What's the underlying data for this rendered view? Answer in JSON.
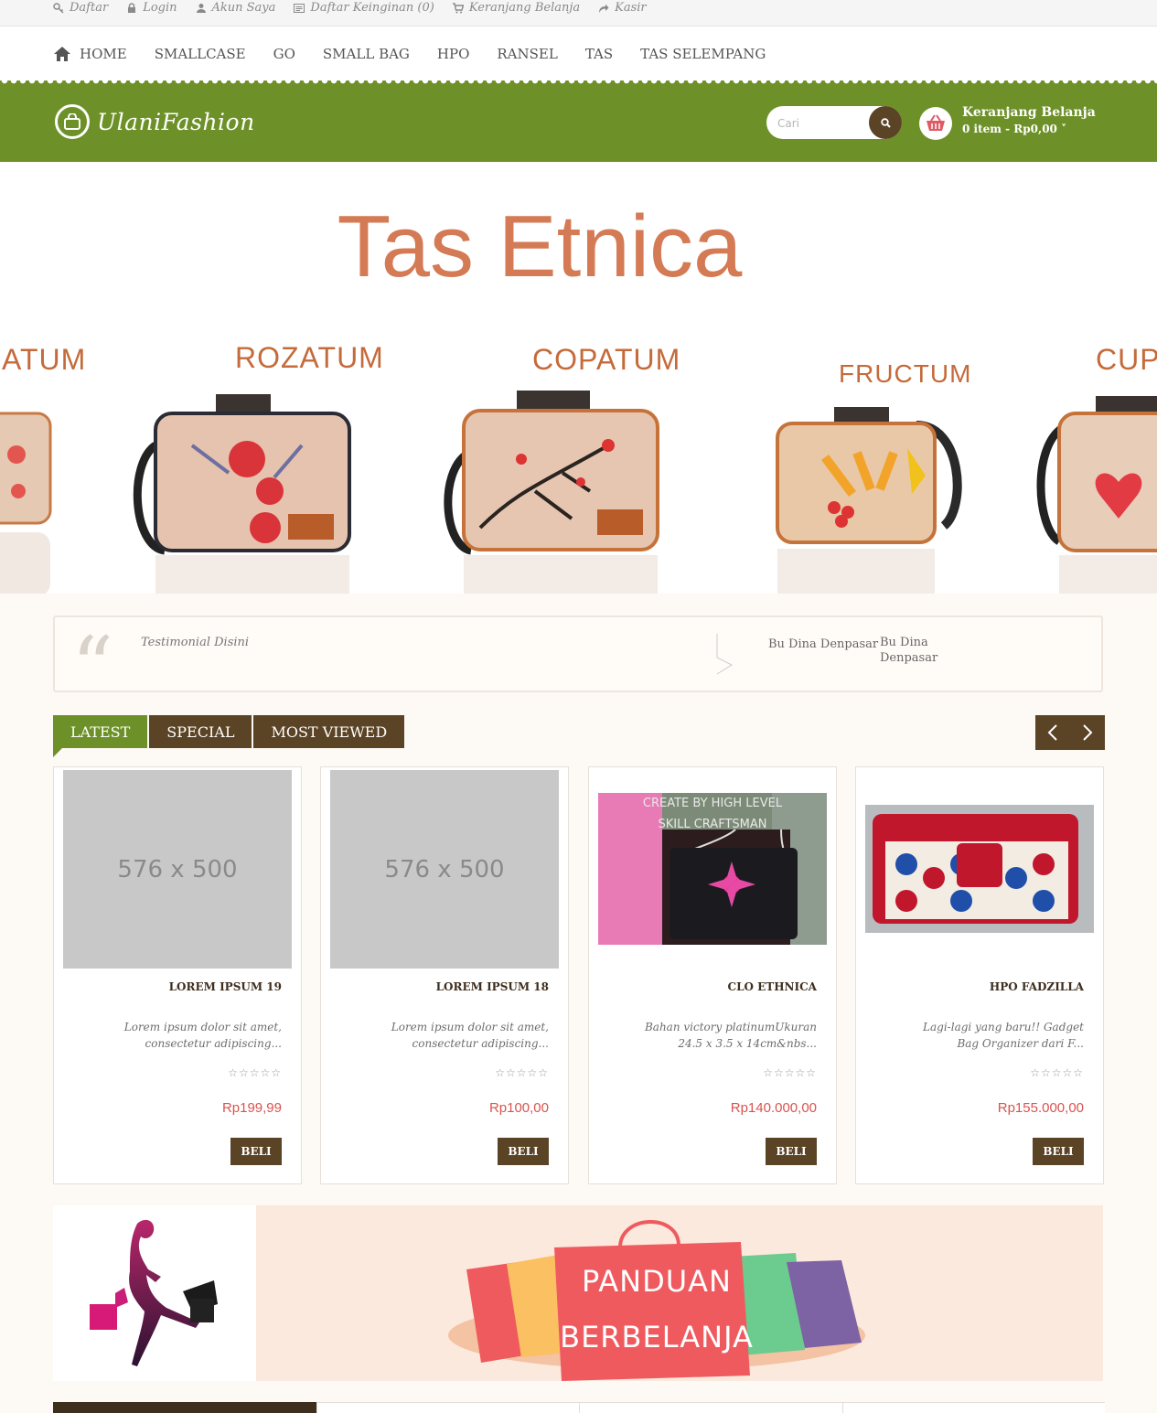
{
  "topbar": {
    "links": [
      {
        "label": "Daftar",
        "icon": "key-icon"
      },
      {
        "label": "Login",
        "icon": "lock-icon"
      },
      {
        "label": "Akun Saya",
        "icon": "user-icon"
      },
      {
        "label": "Daftar Keinginan (0)",
        "icon": "list-icon"
      },
      {
        "label": "Keranjang Belanja",
        "icon": "cart-icon"
      },
      {
        "label": "Kasir",
        "icon": "share-icon"
      }
    ]
  },
  "nav": {
    "items": [
      "HOME",
      "SMALLCASE",
      "GO",
      "SMALL BAG",
      "HPO",
      "RANSEL",
      "TAS",
      "TAS SELEMPANG"
    ]
  },
  "header": {
    "logo_text": "UlaniFashion",
    "search_placeholder": "Cari",
    "cart_title": "Keranjang Belanja",
    "cart_info": "0 item - Rp0,00"
  },
  "banner": {
    "title": "Tas Etnica",
    "products": [
      "ATUM",
      "ROZATUM",
      "COPATUM",
      "FRUCTUM",
      "CUP"
    ]
  },
  "testimonial": {
    "text": "Testimonial Disini",
    "author": "Bu Dina Denpasar",
    "author_name": "Bu Dina Denpasar"
  },
  "tabs": [
    "LATEST",
    "SPECIAL",
    "MOST VIEWED"
  ],
  "products": [
    {
      "name": "LOREM IPSUM 19",
      "desc": "Lorem ipsum dolor sit amet, consectetur adipiscing...",
      "price": "Rp199,99",
      "button": "BELI",
      "image": "576 x 500",
      "stars": "☆☆☆☆☆"
    },
    {
      "name": "LOREM IPSUM 18",
      "desc": "Lorem ipsum dolor sit amet, consectetur adipiscing...",
      "price": "Rp100,00",
      "button": "BELI",
      "image": "576 x 500",
      "stars": "☆☆☆☆☆"
    },
    {
      "name": "CLO ETHNICA",
      "desc": "Bahan victory platinumUkuran 24.5 x 3.5 x 14cm&nbs...",
      "price": "Rp140.000,00",
      "button": "BELI",
      "image_text_1": "CREATE BY HIGH LEVEL",
      "image_text_2": "SKILL CRAFTSMAN",
      "stars": "☆☆☆☆☆"
    },
    {
      "name": "HPO FADZILLA",
      "desc": "Lagi-lagi yang baru!! Gadget Bag Organizer dari F...",
      "price": "Rp155.000,00",
      "button": "BELI",
      "stars": "☆☆☆☆☆"
    }
  ],
  "promo": {
    "line1": "PANDUAN",
    "line2": "BERBELANJA"
  },
  "colors": {
    "green": "#6d9128",
    "brown": "#5b4326",
    "price": "#d9534f",
    "banner_title": "#d47a55"
  }
}
